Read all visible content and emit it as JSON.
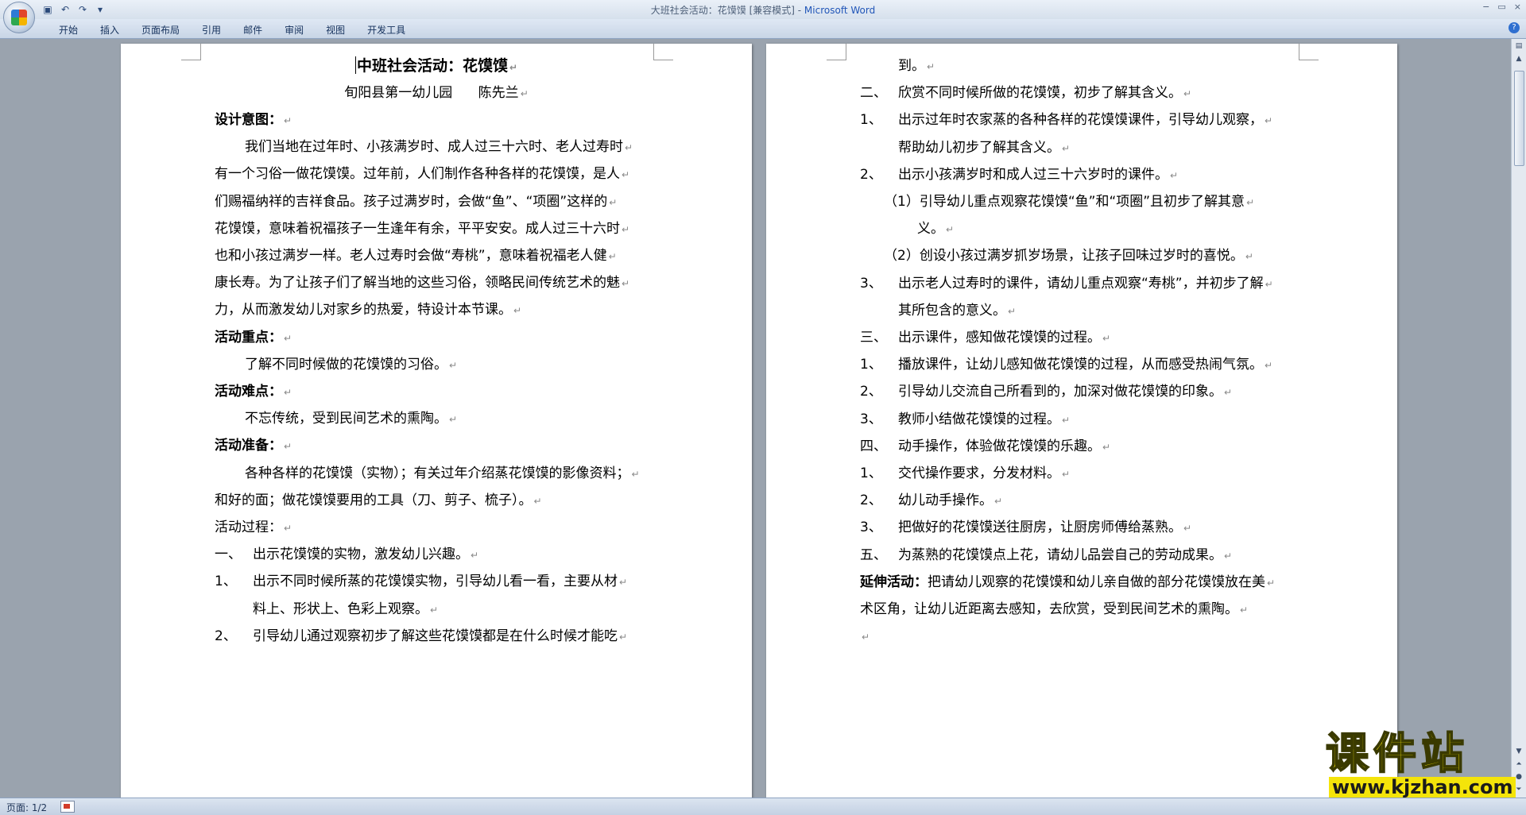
{
  "window": {
    "title": "大班社会活动：花馍馍 [兼容模式] - ",
    "app_name": "Microsoft Word",
    "controls": [
      "−",
      "▭",
      "×"
    ]
  },
  "quick_access": [
    "save-icon",
    "undo-icon",
    "redo-icon",
    "customize-icon"
  ],
  "ribbon": {
    "tabs": [
      "开始",
      "插入",
      "页面布局",
      "引用",
      "邮件",
      "审阅",
      "视图",
      "开发工具"
    ]
  },
  "page_left": {
    "title": "中班社会活动：花馍馍",
    "author": "旬阳县第一幼儿园      陈先兰",
    "lines": [
      {
        "text": "设计意图：",
        "bold": true
      },
      {
        "text": "我们当地在过年时、小孩满岁时、成人过三十六时、老人过寿时",
        "indent": true
      },
      {
        "text": "有一个习俗一做花馍馍。过年前，人们制作各种各样的花馍馍，是人"
      },
      {
        "text": "们赐福纳祥的吉祥食品。孩子过满岁时，会做“鱼”、“项圈”这样的"
      },
      {
        "text": "花馍馍，意味着祝福孩子一生逢年有余，平平安安。成人过三十六时"
      },
      {
        "text": "也和小孩过满岁一样。老人过寿时会做“寿桃”，意味着祝福老人健"
      },
      {
        "text": "康长寿。为了让孩子们了解当地的这些习俗，领略民间传统艺术的魅"
      },
      {
        "text": "力，从而激发幼儿对家乡的热爱，特设计本节课。"
      },
      {
        "text": "活动重点：",
        "bold": true
      },
      {
        "text": "了解不同时候做的花馍馍的习俗。",
        "indent": true
      },
      {
        "text": "活动难点：",
        "bold": true
      },
      {
        "text": "不忘传统，受到民间艺术的熏陶。",
        "indent": true
      },
      {
        "text": "活动准备：",
        "bold": true
      },
      {
        "text": "各种各样的花馍馍（实物）；有关过年介绍蒸花馍馍的影像资料；",
        "indent": true
      },
      {
        "text": "和好的面；做花馍馍要用的工具（刀、剪子、梳子）。"
      },
      {
        "text": "活动过程："
      },
      {
        "num": "一、",
        "text": "出示花馍馍的实物，激发幼儿兴趣。"
      },
      {
        "num": "1、",
        "text": "出示不同时候所蒸的花馍馍实物，引导幼儿看一看，主要从材"
      },
      {
        "cont": true,
        "text": "料上、形状上、色彩上观察。"
      },
      {
        "num": "2、",
        "text": "引导幼儿通过观察初步了解这些花馍馍都是在什么时候才能吃"
      }
    ]
  },
  "page_right": {
    "lines": [
      {
        "cont": true,
        "text": "到。"
      },
      {
        "num": "二、",
        "text": "欣赏不同时候所做的花馍馍，初步了解其含义。"
      },
      {
        "num": "1、",
        "text": "出示过年时农家蒸的各种各样的花馍馍课件，引导幼儿观察，"
      },
      {
        "cont": true,
        "text": "帮助幼儿初步了解其含义。"
      },
      {
        "num": "2、",
        "text": "出示小孩满岁时和成人过三十六岁时的课件。"
      },
      {
        "sub": "（1）",
        "text": "引导幼儿重点观察花馍馍“鱼”和“项圈”且初步了解其意"
      },
      {
        "subcont": true,
        "text": "义。"
      },
      {
        "sub": "（2）",
        "text": "创设小孩过满岁抓岁场景，让孩子回味过岁时的喜悦。"
      },
      {
        "num": "3、",
        "text": "出示老人过寿时的课件，请幼儿重点观察“寿桃”，并初步了解"
      },
      {
        "cont": true,
        "text": "其所包含的意义。"
      },
      {
        "num": "三、",
        "text": "出示课件，感知做花馍馍的过程。"
      },
      {
        "num": "1、",
        "text": "播放课件，让幼儿感知做花馍馍的过程，从而感受热闹气氛。"
      },
      {
        "num": "2、",
        "text": "引导幼儿交流自己所看到的，加深对做花馍馍的印象。"
      },
      {
        "num": "3、",
        "text": "教师小结做花馍馍的过程。"
      },
      {
        "num": "四、",
        "text": "动手操作，体验做花馍馍的乐趣。"
      },
      {
        "num": "1、",
        "text": "交代操作要求，分发材料。"
      },
      {
        "num": "2、",
        "text": "幼儿动手操作。"
      },
      {
        "num": "3、",
        "text": "把做好的花馍馍送往厨房，让厨房师傅给蒸熟。"
      },
      {
        "num": "五、",
        "text": "为蒸熟的花馍馍点上花，请幼儿品尝自己的劳动成果。"
      },
      {
        "lead": "延伸活动：",
        "text": "把请幼儿观察的花馍馍和幼儿亲自做的部分花馍馍放在美"
      },
      {
        "text": "术区角，让幼儿近距离去感知，去欣赏，受到民间艺术的熏陶。"
      },
      {
        "text": ""
      }
    ]
  },
  "paragraph_mark": "↵",
  "status": {
    "page_counter": "页面: 1/2"
  },
  "watermark": {
    "big": "课件站",
    "url": "www.kjzhan.com"
  },
  "colors": {
    "workspace": "#9aa3ae",
    "ribbon": "#c8d5e6",
    "watermark_yellow": "#f4e40a"
  }
}
